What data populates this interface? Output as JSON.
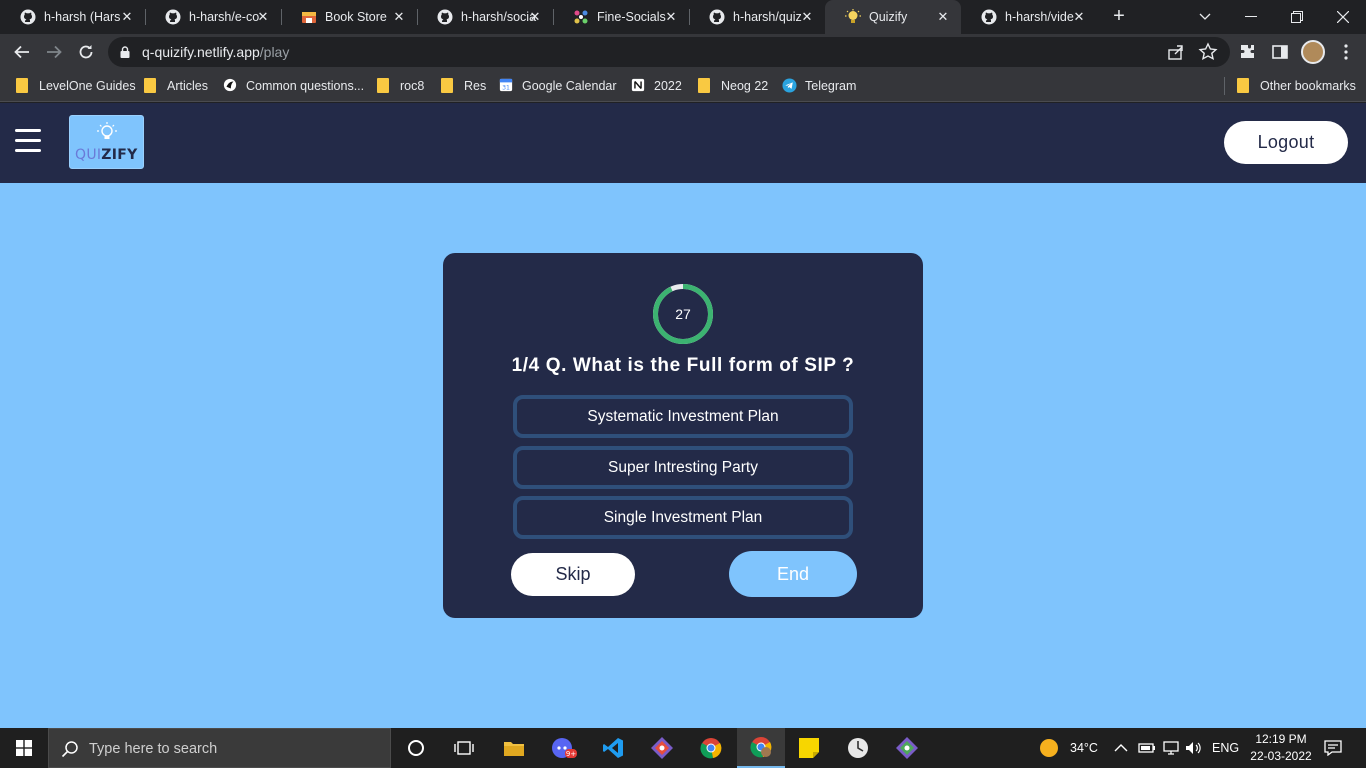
{
  "browser": {
    "tabs": [
      {
        "title": "h-harsh (Hars",
        "icon": "github-icon",
        "active": false
      },
      {
        "title": "h-harsh/e-co",
        "icon": "github-icon",
        "active": false
      },
      {
        "title": "Book Store",
        "icon": "book-store-icon",
        "active": false
      },
      {
        "title": "h-harsh/socia",
        "icon": "github-icon",
        "active": false
      },
      {
        "title": "Fine-Socials",
        "icon": "fine-socials-icon",
        "active": false
      },
      {
        "title": "h-harsh/quiz",
        "icon": "github-icon",
        "active": false
      },
      {
        "title": "Quizify",
        "icon": "lightbulb-icon",
        "active": true
      },
      {
        "title": "h-harsh/vide",
        "icon": "github-icon",
        "active": false
      }
    ],
    "url": {
      "host": "q-quizify.netlify.app",
      "path": "/play"
    },
    "bookmarks": [
      {
        "label": "LevelOne Guides",
        "icon": "folder-icon"
      },
      {
        "label": "Articles",
        "icon": "folder-icon"
      },
      {
        "label": "Common questions...",
        "icon": "site-icon"
      },
      {
        "label": "roc8",
        "icon": "folder-icon"
      },
      {
        "label": "Res",
        "icon": "folder-icon"
      },
      {
        "label": "Google Calendar",
        "icon": "calendar-icon"
      },
      {
        "label": "2022",
        "icon": "notion-icon"
      },
      {
        "label": "Neog 22",
        "icon": "folder-icon"
      },
      {
        "label": "Telegram",
        "icon": "telegram-icon"
      }
    ],
    "other_bookmarks": "Other bookmarks"
  },
  "app": {
    "logo": {
      "part1": "QUI",
      "part2": "ZIFY"
    },
    "logout_label": "Logout",
    "colors": {
      "header": "#232a48",
      "background": "#7fc4fd",
      "timer": "#3cb371"
    }
  },
  "quiz": {
    "timer": "27",
    "timer_fraction": 0.93,
    "question": "1/4 Q. What is the Full form of SIP ?",
    "options": [
      "Systematic Investment Plan",
      "Super Intresting Party",
      "Single Investment Plan"
    ],
    "skip_label": "Skip",
    "end_label": "End"
  },
  "taskbar": {
    "search_placeholder": "Type here to search",
    "weather": "34°C",
    "language": "ENG",
    "time": "12:19 PM",
    "date": "22-03-2022",
    "badge": "9+"
  }
}
